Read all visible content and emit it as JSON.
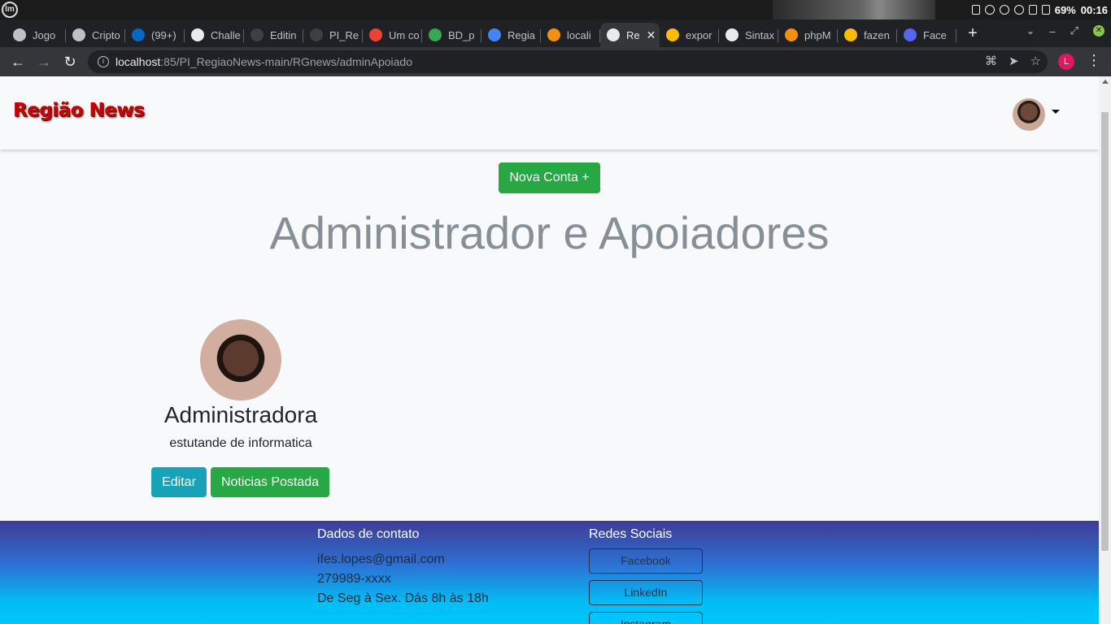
{
  "os": {
    "logo": "lm",
    "battery": "69%",
    "clock": "00:16"
  },
  "tabs": [
    {
      "label": "Jogo",
      "icon": "globe-icon",
      "color": "#bdc1c6"
    },
    {
      "label": "Cripto",
      "icon": "globe-icon",
      "color": "#bdc1c6"
    },
    {
      "label": "(99+)",
      "icon": "linkedin-icon",
      "color": "#0a66c2"
    },
    {
      "label": "Challe",
      "icon": "trello-icon",
      "color": "#e8eaed"
    },
    {
      "label": "Editin",
      "icon": "github-icon",
      "color": "#3c4043"
    },
    {
      "label": "PI_Re",
      "icon": "github-icon",
      "color": "#3c4043"
    },
    {
      "label": "Um co",
      "icon": "gmail-icon",
      "color": "#ea4335"
    },
    {
      "label": "BD_p",
      "icon": "drive-icon",
      "color": "#34a853"
    },
    {
      "label": "Regia",
      "icon": "docs-icon",
      "color": "#4285f4"
    },
    {
      "label": "locali",
      "icon": "phpmyadmin-icon",
      "color": "#f29111"
    },
    {
      "label": "Re",
      "icon": "globe-icon",
      "color": "#e8eaed",
      "active": true
    },
    {
      "label": "expor",
      "icon": "google-icon",
      "color": "#fbbc05"
    },
    {
      "label": "Sintax",
      "icon": "github-icon",
      "color": "#e8eaed"
    },
    {
      "label": "phpM",
      "icon": "phpmyadmin-icon",
      "color": "#f29111"
    },
    {
      "label": "fazen",
      "icon": "google-icon",
      "color": "#fbbc05"
    },
    {
      "label": "Face",
      "icon": "terminal-icon",
      "color": "#5865f2"
    }
  ],
  "toolbar": {
    "url_host": "localhost",
    "url_rest": ":85/PI_RegiaoNews-main/RGnews/adminApoiado",
    "profile_initial": "L"
  },
  "navbar": {
    "brand": "Região News"
  },
  "page": {
    "new_account_button": "Nova Conta +",
    "heading": "Administrador e Apoiadores"
  },
  "profile": {
    "name": "Administradora",
    "description": "estutande de informatica",
    "edit_button": "Editar",
    "news_button": "Noticias Postada"
  },
  "footer": {
    "contact_title": "Dados de contato",
    "email": "ifes.lopes@gmail.com",
    "phone": "279989-xxxx",
    "hours": "De Seg à Sex. Dás 8h às 18h",
    "social_title": "Redes Sociais",
    "social": [
      "Facebook",
      "LinkedIn",
      "Instagram"
    ]
  },
  "colors": {
    "success": "#28a745",
    "info": "#17a2b8",
    "brand": "#c40000"
  }
}
